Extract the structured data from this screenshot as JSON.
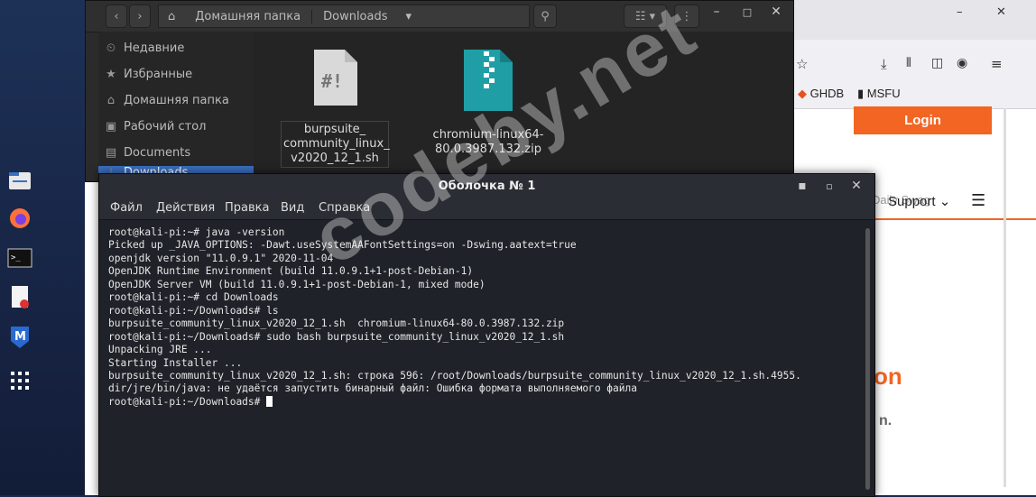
{
  "dock": {
    "icons": [
      "files-icon",
      "firefox-icon",
      "terminal-icon",
      "text-editor-icon",
      "metasploit-icon",
      "app-grid-icon"
    ]
  },
  "browser": {
    "bookmarks": [
      {
        "label": "GHDB"
      },
      {
        "label": "MSFU"
      }
    ],
    "login_label": "Login",
    "nav_support": "Support",
    "partial_text": "Daily Swag",
    "partial_heading": "on",
    "partial_sub": "n."
  },
  "file_manager": {
    "breadcrumb": [
      "Домашняя папка",
      "Downloads"
    ],
    "sidebar": [
      {
        "label": "Недавние",
        "icon": "clock-icon"
      },
      {
        "label": "Избранные",
        "icon": "star-icon"
      },
      {
        "label": "Домашняя папка",
        "icon": "home-icon"
      },
      {
        "label": "Рабочий стол",
        "icon": "desktop-icon"
      },
      {
        "label": "Documents",
        "icon": "document-icon"
      },
      {
        "label": "Downloads",
        "icon": "download-icon"
      }
    ],
    "files": [
      {
        "name_lines": [
          "burpsuite_",
          "community_linux_",
          "v2020_12_1.sh"
        ],
        "icon": "script-file-icon"
      },
      {
        "name_lines": [
          "chromium-linux64-",
          "80.0.3987.132.zip"
        ],
        "icon": "zip-file-icon"
      }
    ]
  },
  "terminal": {
    "title": "Оболочка № 1",
    "menu": [
      "Файл",
      "Действия",
      "Правка",
      "Вид",
      "Справка"
    ],
    "lines": [
      "root@kali-pi:~# java -version",
      "Picked up _JAVA_OPTIONS: -Dawt.useSystemAAFontSettings=on -Dswing.aatext=true",
      "openjdk version \"11.0.9.1\" 2020-11-04",
      "OpenJDK Runtime Environment (build 11.0.9.1+1-post-Debian-1)",
      "OpenJDK Server VM (build 11.0.9.1+1-post-Debian-1, mixed mode)",
      "root@kali-pi:~# cd Downloads",
      "root@kali-pi:~/Downloads# ls",
      "burpsuite_community_linux_v2020_12_1.sh  chromium-linux64-80.0.3987.132.zip",
      "root@kali-pi:~/Downloads# sudo bash burpsuite_community_linux_v2020_12_1.sh",
      "Unpacking JRE ...",
      "Starting Installer ...",
      "burpsuite_community_linux_v2020_12_1.sh: строка 596: /root/Downloads/burpsuite_community_linux_v2020_12_1.sh.4955.",
      "dir/jre/bin/java: не удаётся запустить бинарный файл: Ошибка формата выполняемого файла",
      "root@kali-pi:~/Downloads# "
    ]
  },
  "watermark": "codeby.net",
  "colors": {
    "accent": "#f26522",
    "selection": "#3a6fbf",
    "terminal_bg": "#1f2228"
  }
}
